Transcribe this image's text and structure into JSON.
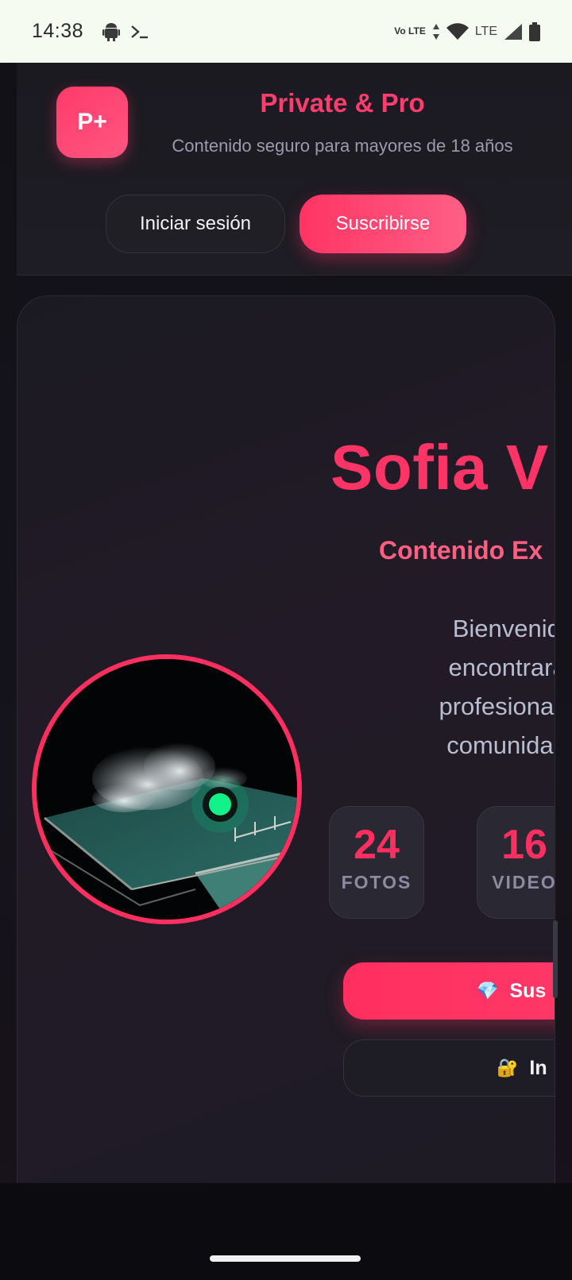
{
  "status_bar": {
    "time": "14:38",
    "volte_label": "Vo LTE",
    "lte_label": "LTE"
  },
  "header": {
    "logo_text": "P+",
    "brand_name": "Private & Pro",
    "tagline": "Contenido seguro para mayores de 18 años",
    "login_label": "Iniciar sesión",
    "subscribe_label": "Suscribirse"
  },
  "profile": {
    "name": "Sofia V",
    "subtitle": "Contenido Ex",
    "bio_lines": [
      "Bienvenido a mi",
      "encontrarás cont",
      "profesionales y vic",
      "comunidad VIP p"
    ],
    "online": true,
    "stats": [
      {
        "value": "24",
        "label": "FOTOS"
      },
      {
        "value": "16",
        "label": "VIDEO"
      }
    ],
    "cta_main": {
      "icon": "💎",
      "label": "Sus"
    },
    "cta_secondary": {
      "icon": "🔐",
      "label": "In"
    }
  },
  "colors": {
    "accent": "#ff3466",
    "online": "#12f08a",
    "background": "#121118"
  }
}
